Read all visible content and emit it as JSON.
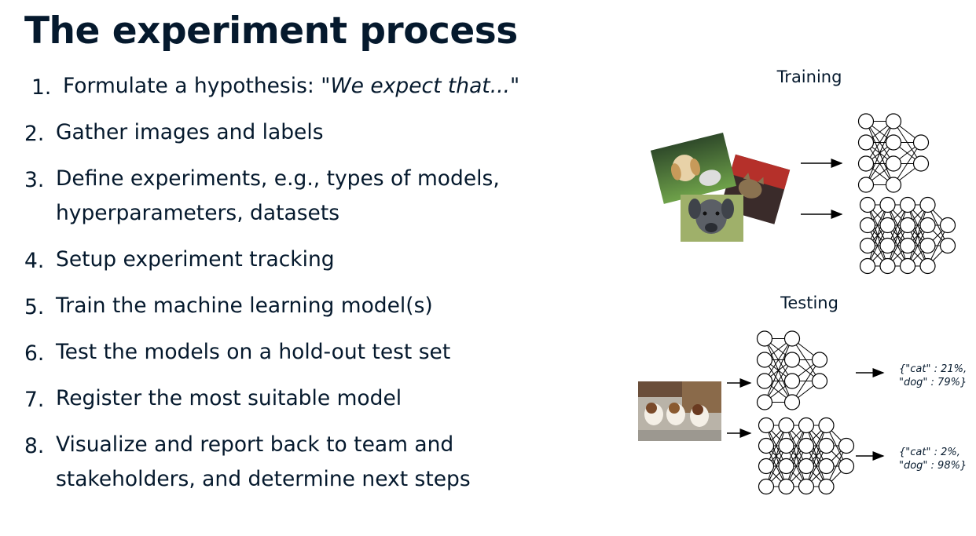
{
  "slide": {
    "title": "The experiment process",
    "steps": [
      {
        "num": "1.",
        "text": "Formulate a hypothesis: ",
        "hypothesis": "\"We expect that...\""
      },
      {
        "num": "2.",
        "text": "Gather images and labels"
      },
      {
        "num": "3.",
        "text": "Define experiments, e.g., types of models,",
        "text2": "hyperparameters, datasets"
      },
      {
        "num": "4.",
        "text": "Setup experiment tracking"
      },
      {
        "num": "5.",
        "text": "Train the machine learning model(s)"
      },
      {
        "num": "6.",
        "text": "Test the models on a hold-out test set"
      },
      {
        "num": "7.",
        "text": "Register the most suitable model"
      },
      {
        "num": "8.",
        "text": "Visualize and report back to team and",
        "text2": "stakeholders, and determine next steps"
      }
    ]
  },
  "diagram": {
    "training_label": "Training",
    "testing_label": "Testing",
    "outputs": [
      {
        "line1": "{\"cat\" : 21%,",
        "line2": "\"dog\" : 79%}"
      },
      {
        "line1": "{\"cat\" : 2%,",
        "line2": "\"dog\" : 98%}"
      }
    ]
  },
  "colors": {
    "text": "#05192d",
    "background": "#ffffff"
  }
}
